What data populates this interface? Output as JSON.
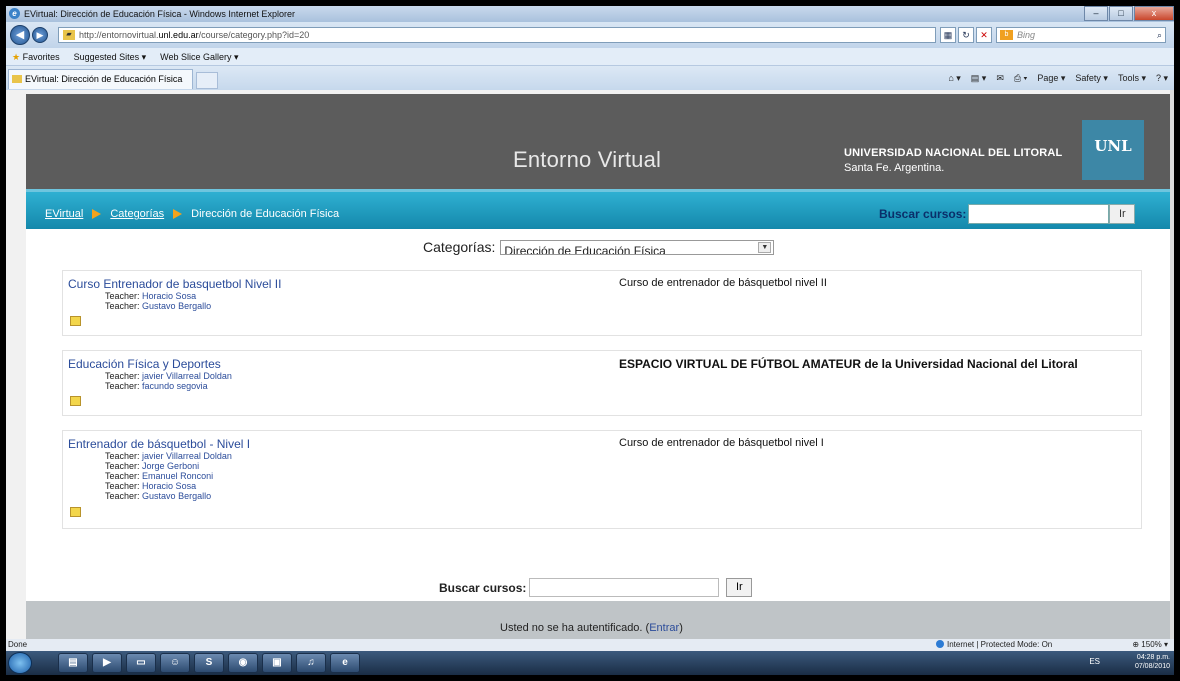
{
  "window": {
    "title": "EVirtual: Dirección de Educación Física - Windows Internet Explorer",
    "minimize": "–",
    "maximize": "□",
    "close": "x"
  },
  "addressbar": {
    "url_prefix": "http://entornovirtual.",
    "url_domain": "unl.edu.ar",
    "url_suffix": "/course/category.php?id=20",
    "search_placeholder": "Bing"
  },
  "favorites": {
    "label": "Favorites",
    "items": [
      "Suggested Sites ▾",
      "Web Slice Gallery ▾"
    ]
  },
  "tab": {
    "label": "EVirtual: Dirección de Educación Física"
  },
  "commandbar": [
    "Page ▾",
    "Safety ▾",
    "Tools ▾"
  ],
  "site": {
    "title": "Entorno Virtual",
    "university_name": "UNIVERSIDAD NACIONAL DEL LITORAL",
    "university_location": "Santa Fe. Argentina.",
    "logo_text": "UNL"
  },
  "breadcrumb": {
    "home": "EVirtual",
    "categories": "Categorías",
    "current": "Dirección de Educación Física"
  },
  "navsearch": {
    "label": "Buscar cursos:",
    "button": "Ir"
  },
  "category_select": {
    "label": "Categorías:",
    "selected": "Dirección de Educación Física"
  },
  "courses": [
    {
      "name": "Curso Entrenador de basquetbol Nivel II",
      "teachers": [
        {
          "role": "Teacher:",
          "name": "Horacio Sosa"
        },
        {
          "role": "Teacher:",
          "name": "Gustavo Bergallo"
        }
      ],
      "summary": "Curso de entrenador de básquetbol nivel II"
    },
    {
      "name": "Educación Física y Deportes",
      "teachers": [
        {
          "role": "Teacher:",
          "name": "javier Villarreal Doldan"
        },
        {
          "role": "Teacher:",
          "name": "facundo segovia"
        }
      ],
      "summary": "ESPACIO VIRTUAL DE FÚTBOL AMATEUR de la Universidad Nacional del Litoral"
    },
    {
      "name": "Entrenador de básquetbol - Nivel I",
      "teachers": [
        {
          "role": "Teacher:",
          "name": "javier Villarreal Doldan"
        },
        {
          "role": "Teacher:",
          "name": "Jorge Gerboni"
        },
        {
          "role": "Teacher:",
          "name": "Emanuel Ronconi"
        },
        {
          "role": "Teacher:",
          "name": "Horacio Sosa"
        },
        {
          "role": "Teacher:",
          "name": "Gustavo Bergallo"
        }
      ],
      "summary": "Curso de entrenador de básquetbol nivel I"
    }
  ],
  "bottom_search": {
    "label": "Buscar cursos:",
    "button": "Ir"
  },
  "footer": {
    "text": "Usted no se ha autentificado. (",
    "link": "Entrar",
    "text_end": ")"
  },
  "status": {
    "left": "Done",
    "zone": "Internet | Protected Mode: On",
    "zoom": "150% ▾"
  },
  "tray": {
    "lang": "ES",
    "time": "04:28 p.m.",
    "date": "07/08/2010"
  }
}
